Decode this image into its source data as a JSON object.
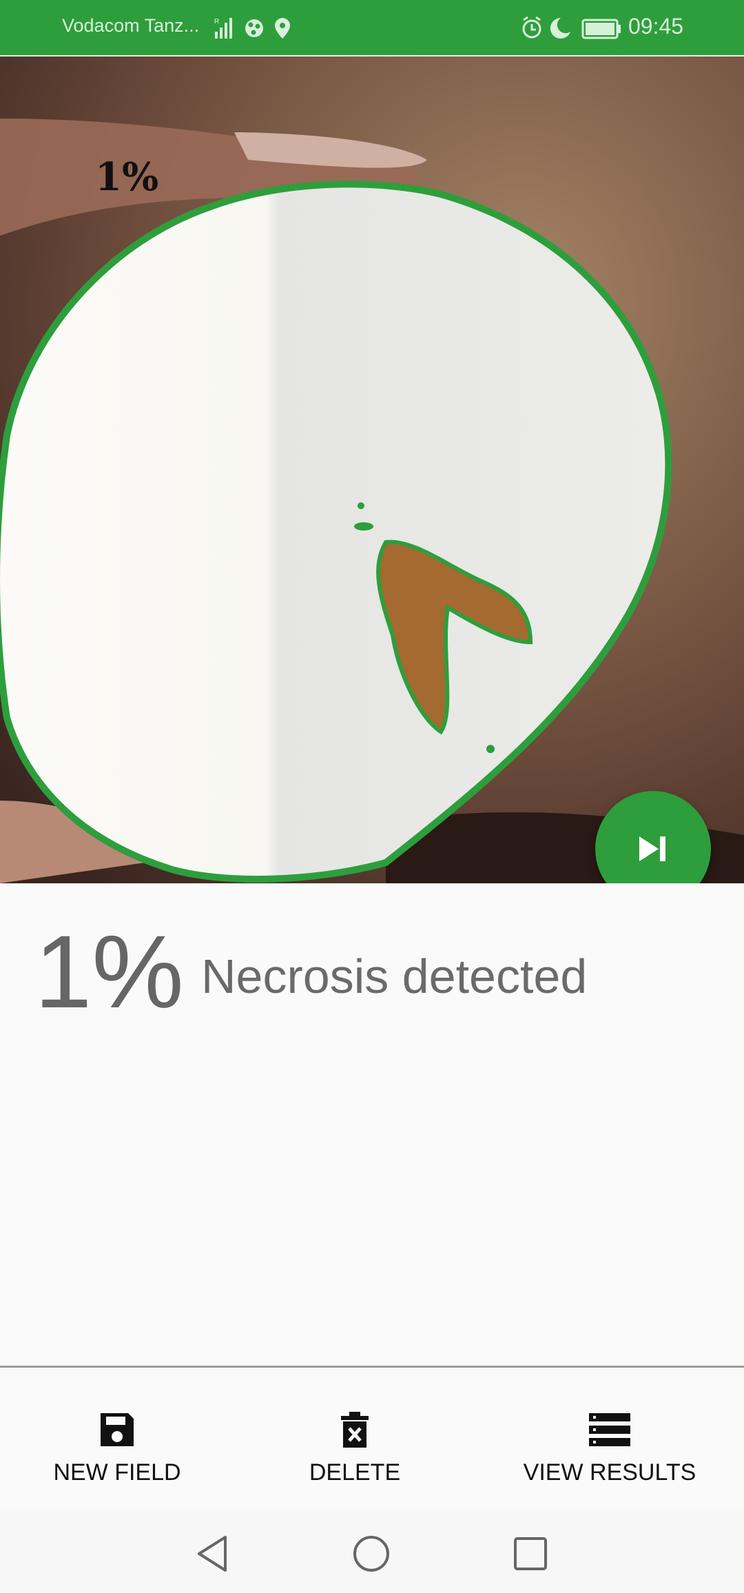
{
  "status_bar": {
    "carrier": "Vodacom Tanz...",
    "time": "09:45",
    "icons": [
      "signal-icon",
      "data-icon",
      "location-icon",
      "alarm-icon",
      "moon-icon",
      "battery-icon"
    ]
  },
  "photo": {
    "overlay_percent": "1%",
    "outline_color": "#2e9e3c"
  },
  "fab": {
    "icon": "skip-next-icon",
    "color": "#2e9e3c"
  },
  "result": {
    "percent": "1%",
    "label": "Necrosis detected"
  },
  "bottom_nav": {
    "new_field": {
      "label": "NEW FIELD",
      "icon": "save-icon"
    },
    "delete": {
      "label": "DELETE",
      "icon": "delete-icon"
    },
    "view_results": {
      "label": "VIEW RESULTS",
      "icon": "list-icon"
    }
  },
  "system_nav": {
    "icons": [
      "back-icon",
      "home-icon",
      "recents-icon"
    ]
  },
  "colors": {
    "accent": "#2e9e3c",
    "background": "#fafafa"
  }
}
